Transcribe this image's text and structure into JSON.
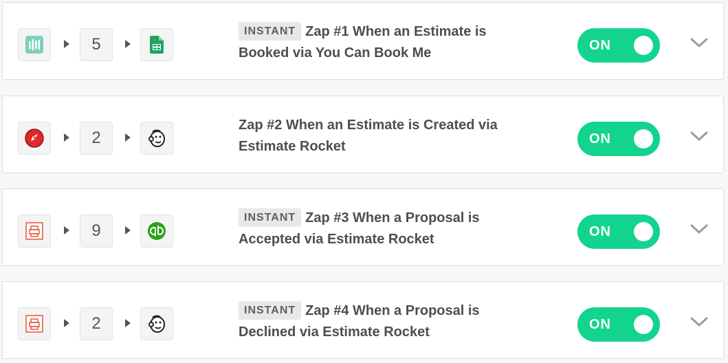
{
  "colors": {
    "toggle_on": "#13d48e",
    "card_border": "#dcdcdc"
  },
  "zaps": [
    {
      "trigger_icon": "youcanbookme-icon",
      "steps": "5",
      "action_icon": "google-sheets-icon",
      "instant_label": "INSTANT",
      "title": "Zap #1 When an Estimate is Booked via You Can Book Me",
      "toggle_label": "ON"
    },
    {
      "trigger_icon": "estimate-rocket-icon",
      "steps": "2",
      "action_icon": "mailchimp-icon",
      "instant_label": "",
      "title": "Zap #2 When an Estimate is Created via Estimate Rocket",
      "toggle_label": "ON"
    },
    {
      "trigger_icon": "estimate-rocket-document-icon",
      "steps": "9",
      "action_icon": "quickbooks-icon",
      "instant_label": "INSTANT",
      "title": "Zap #3 When a Proposal is Accepted via Estimate Rocket",
      "toggle_label": "ON"
    },
    {
      "trigger_icon": "estimate-rocket-document-icon",
      "steps": "2",
      "action_icon": "mailchimp-icon",
      "instant_label": "INSTANT",
      "title": "Zap #4 When a Proposal is Declined via Estimate Rocket",
      "toggle_label": "ON"
    }
  ]
}
